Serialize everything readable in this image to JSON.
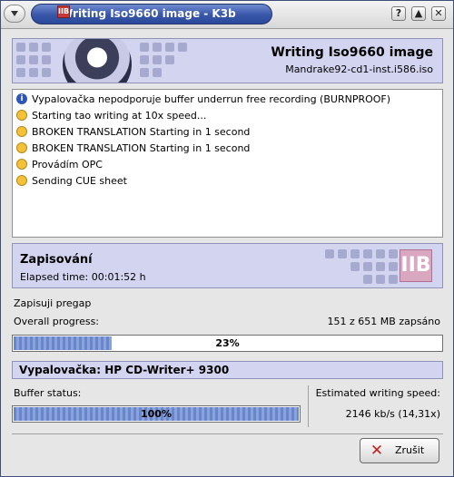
{
  "window": {
    "title": "Writing Iso9660 image - K3b",
    "logo_text": "IIB",
    "buttons": [
      "?",
      "▲",
      "✕"
    ]
  },
  "header": {
    "title": "Writing Iso9660 image",
    "subtitle": "Mandrake92-cd1-inst.i586.iso"
  },
  "log": {
    "items": [
      {
        "icon": "info-icon",
        "text": "Vypalovačka nepodporuje buffer underrun free recording (BURNPROOF)"
      },
      {
        "icon": "note-icon",
        "text": "Starting tao writing at 10x speed..."
      },
      {
        "icon": "note-icon",
        "text": "BROKEN TRANSLATION Starting in 1 second"
      },
      {
        "icon": "note-icon",
        "text": "BROKEN TRANSLATION Starting in 1 second"
      },
      {
        "icon": "note-icon",
        "text": "Provádím OPC"
      },
      {
        "icon": "note-icon",
        "text": "Sending CUE sheet"
      }
    ]
  },
  "status": {
    "title": "Zapisování",
    "elapsed": "Elapsed time: 00:01:52 h",
    "logo_text": "IIB"
  },
  "progress": {
    "task_label": "Zapisuji pregap",
    "overall_label": "Overall progress:",
    "overall_amount": "151 z 651 MB zapsáno",
    "overall_percent_text": "23%",
    "overall_fraction": 0.23
  },
  "device": {
    "label": "Vypalovačka: HP CD-Writer+ 9300"
  },
  "buffer": {
    "label": "Buffer status:",
    "percent_text": "100%",
    "fraction": 1.0
  },
  "speed": {
    "label": "Estimated writing speed:",
    "value": "2146 kb/s (14,31x)"
  },
  "actions": {
    "cancel_label": "Zrušit"
  },
  "colors": {
    "panel_bg": "#d3d4f0",
    "title_bar_accent": "#3856a8",
    "progress_fill": "#6a86c9",
    "cancel_icon": "#c52020"
  }
}
